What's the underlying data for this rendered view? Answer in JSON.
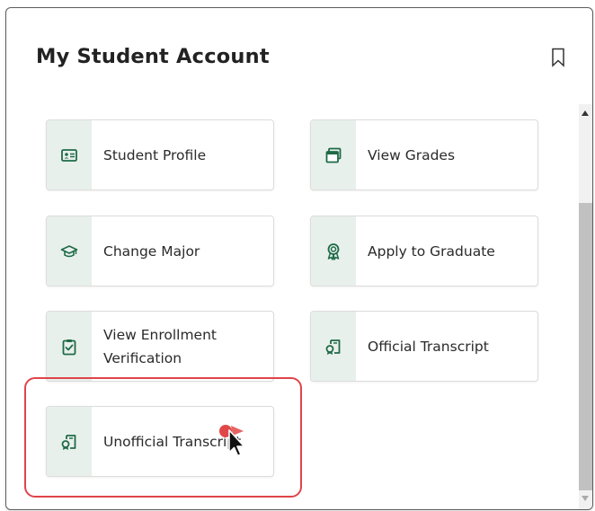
{
  "card": {
    "title": "My Student Account",
    "bookmark_icon": "bookmark-icon"
  },
  "tiles": [
    {
      "label": "Student Profile",
      "icon": "id-card-icon"
    },
    {
      "label": "View Grades",
      "icon": "stacked-windows-icon"
    },
    {
      "label": "Change Major",
      "icon": "graduation-cap-icon"
    },
    {
      "label": "Apply to Graduate",
      "icon": "award-ribbon-icon"
    },
    {
      "label": "View Enrollment Verification",
      "icon": "clipboard-check-icon"
    },
    {
      "label": "Official Transcript",
      "icon": "transcript-seal-icon"
    },
    {
      "label": "Unofficial Transcript",
      "icon": "transcript-seal-icon"
    }
  ],
  "colors": {
    "icon_green": "#1f6b47",
    "icon_bg": "#e8f0ec",
    "highlight": "#e0444a"
  }
}
